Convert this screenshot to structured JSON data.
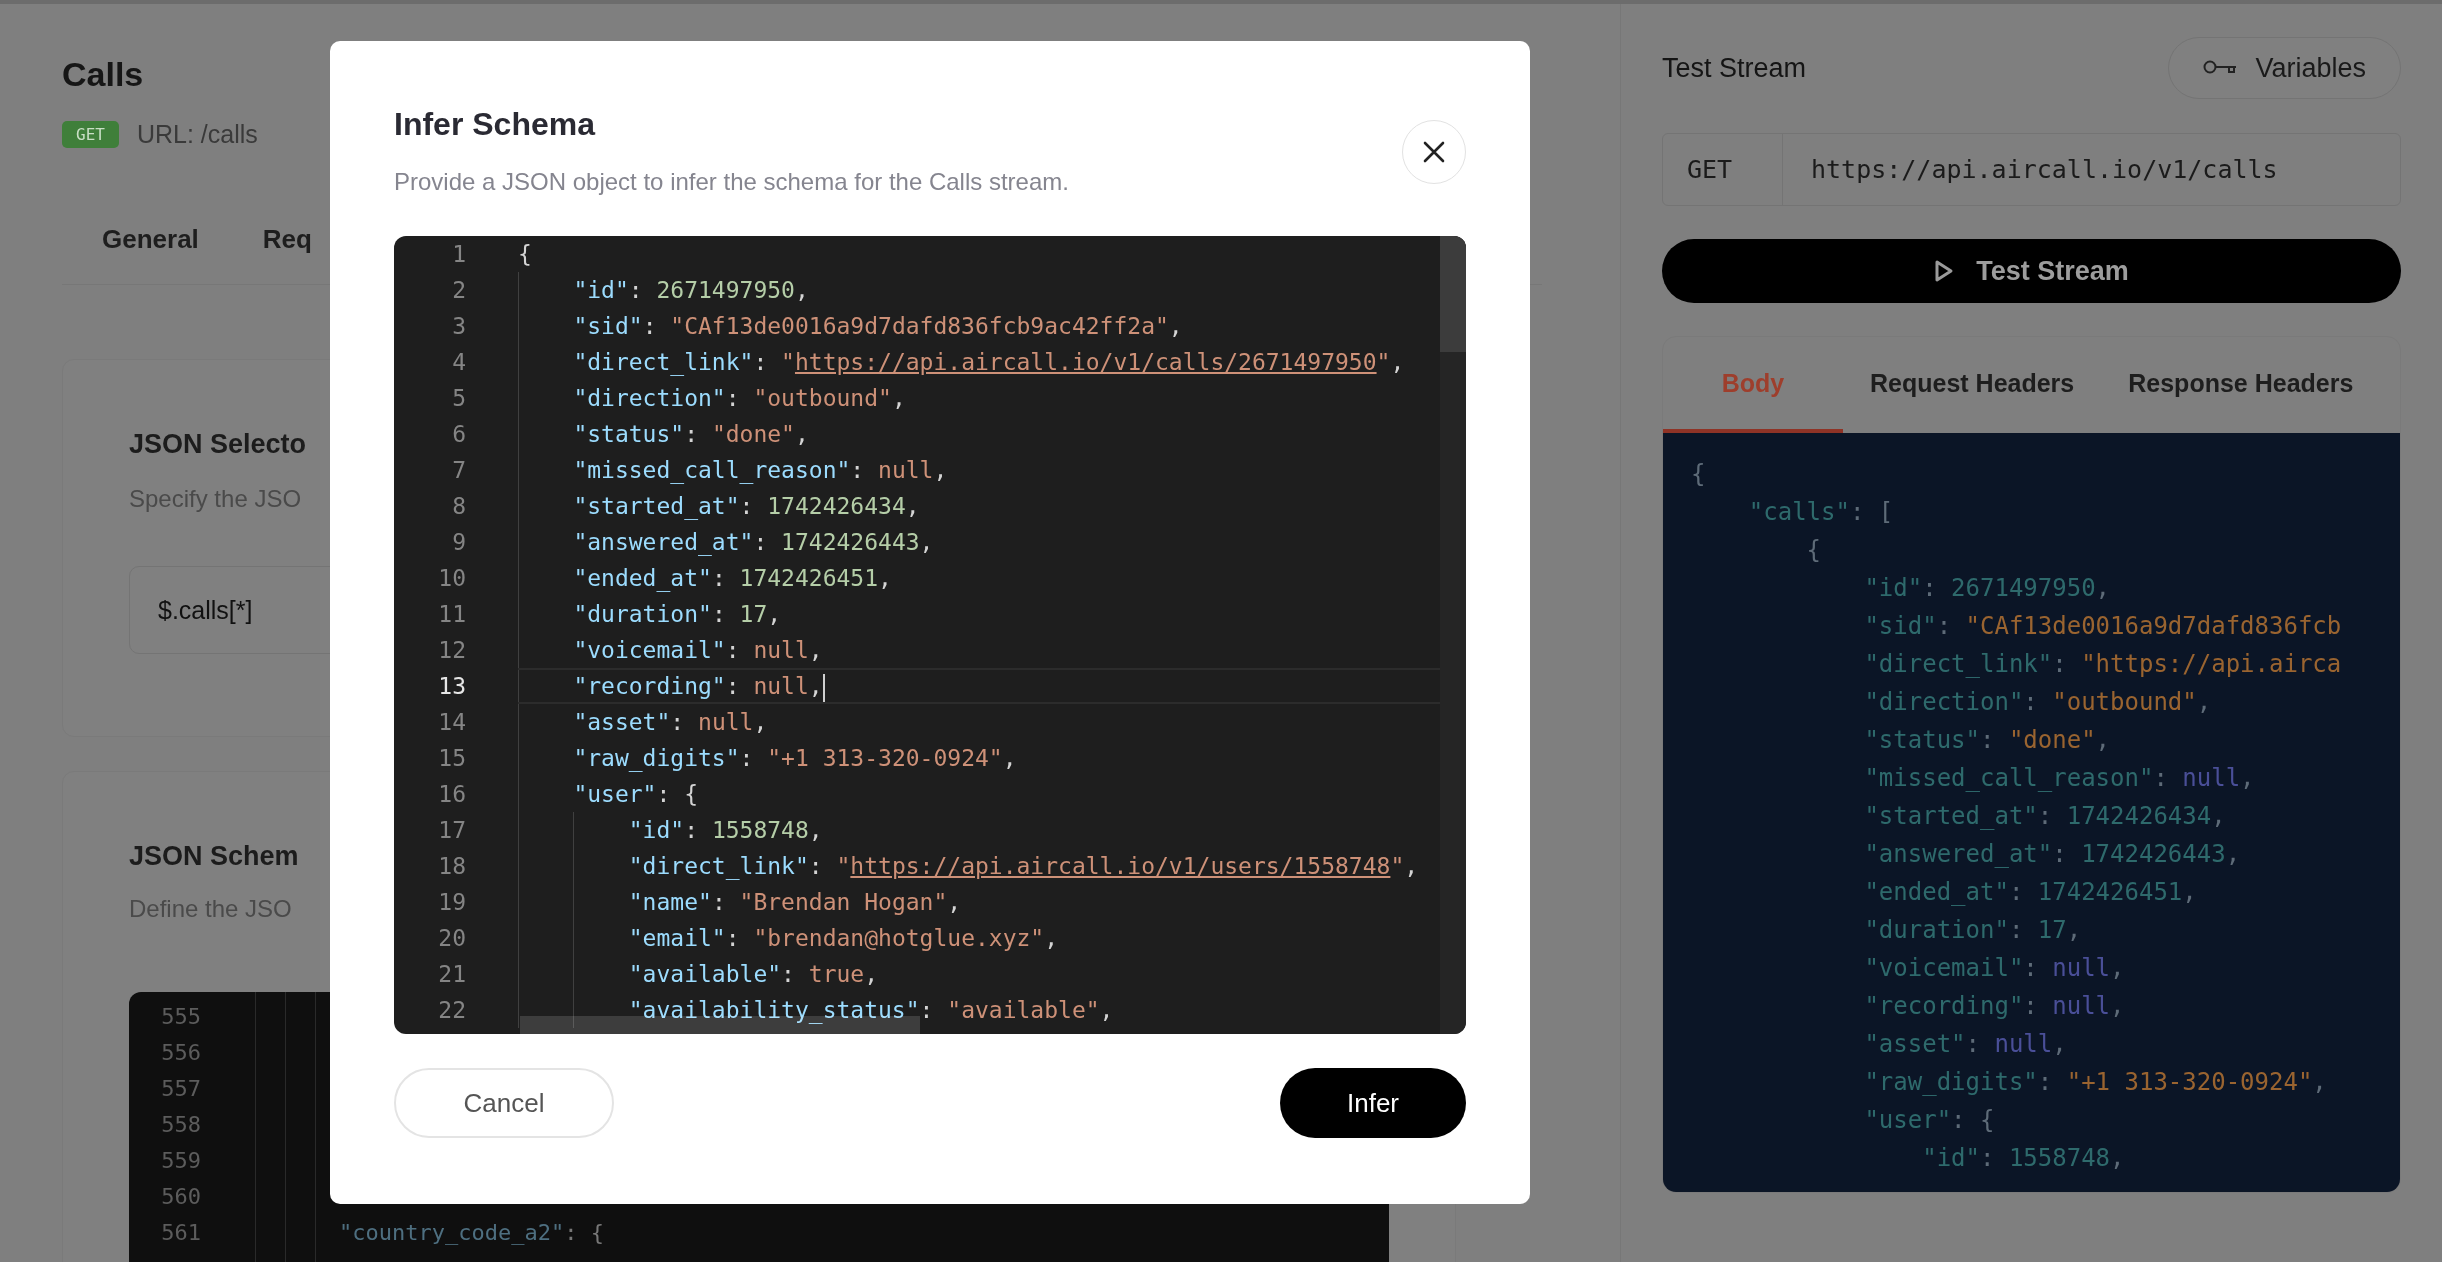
{
  "page": {
    "title": "Calls",
    "method_badge": "GET",
    "url_label": "URL: /calls",
    "tabs": [
      "General",
      "Req"
    ],
    "json_selector": {
      "title": "JSON Selecto",
      "description": "Specify the JSO",
      "value": "$.calls[*]"
    },
    "json_schema": {
      "title": "JSON Schem",
      "description": "Define the JSO",
      "editor": {
        "lines": [
          {
            "number": "555"
          },
          {
            "number": "556"
          },
          {
            "number": "557"
          },
          {
            "number": "558"
          },
          {
            "number": "559"
          },
          {
            "number": "560"
          },
          {
            "number": "561",
            "tokens": [
              {
                "kind": "key",
                "text": "\"country_code_a2\""
              },
              {
                "kind": "punct",
                "text": ": {"
              }
            ]
          }
        ]
      }
    }
  },
  "test_panel": {
    "title": "Test Stream",
    "variables_button": "Variables",
    "method": "GET",
    "url": "https://api.aircall.io/v1/calls",
    "test_button": "Test Stream",
    "response": {
      "tabs": [
        {
          "label": "Body",
          "selected": true
        },
        {
          "label": "Request Headers",
          "selected": false
        },
        {
          "label": "Response Headers",
          "selected": false
        }
      ],
      "body_lines": [
        {
          "tokens": [
            {
              "kind": "punct",
              "text": "{"
            }
          ]
        },
        {
          "tokens": [
            {
              "kind": "key",
              "text": "    \"calls\""
            },
            {
              "kind": "punct",
              "text": ": ["
            }
          ]
        },
        {
          "tokens": [
            {
              "kind": "punct",
              "text": "        {"
            }
          ]
        },
        {
          "tokens": [
            {
              "kind": "key",
              "text": "            \"id\""
            },
            {
              "kind": "punct",
              "text": ": "
            },
            {
              "kind": "num",
              "text": "2671497950"
            },
            {
              "kind": "punct",
              "text": ","
            }
          ]
        },
        {
          "tokens": [
            {
              "kind": "key",
              "text": "            \"sid\""
            },
            {
              "kind": "punct",
              "text": ": "
            },
            {
              "kind": "str",
              "text": "\"CAf13de0016a9d7dafd836fcb"
            }
          ]
        },
        {
          "tokens": [
            {
              "kind": "key",
              "text": "            \"direct_link\""
            },
            {
              "kind": "punct",
              "text": ": "
            },
            {
              "kind": "str",
              "text": "\"https://api.airca"
            }
          ]
        },
        {
          "tokens": [
            {
              "kind": "key",
              "text": "            \"direction\""
            },
            {
              "kind": "punct",
              "text": ": "
            },
            {
              "kind": "str",
              "text": "\"outbound\""
            },
            {
              "kind": "punct",
              "text": ","
            }
          ]
        },
        {
          "tokens": [
            {
              "kind": "key",
              "text": "            \"status\""
            },
            {
              "kind": "punct",
              "text": ": "
            },
            {
              "kind": "str",
              "text": "\"done\""
            },
            {
              "kind": "punct",
              "text": ","
            }
          ]
        },
        {
          "tokens": [
            {
              "kind": "key",
              "text": "            \"missed_call_reason\""
            },
            {
              "kind": "punct",
              "text": ": "
            },
            {
              "kind": "lit",
              "text": "null"
            },
            {
              "kind": "punct",
              "text": ","
            }
          ]
        },
        {
          "tokens": [
            {
              "kind": "key",
              "text": "            \"started_at\""
            },
            {
              "kind": "punct",
              "text": ": "
            },
            {
              "kind": "num",
              "text": "1742426434"
            },
            {
              "kind": "punct",
              "text": ","
            }
          ]
        },
        {
          "tokens": [
            {
              "kind": "key",
              "text": "            \"answered_at\""
            },
            {
              "kind": "punct",
              "text": ": "
            },
            {
              "kind": "num",
              "text": "1742426443"
            },
            {
              "kind": "punct",
              "text": ","
            }
          ]
        },
        {
          "tokens": [
            {
              "kind": "key",
              "text": "            \"ended_at\""
            },
            {
              "kind": "punct",
              "text": ": "
            },
            {
              "kind": "num",
              "text": "1742426451"
            },
            {
              "kind": "punct",
              "text": ","
            }
          ]
        },
        {
          "tokens": [
            {
              "kind": "key",
              "text": "            \"duration\""
            },
            {
              "kind": "punct",
              "text": ": "
            },
            {
              "kind": "num",
              "text": "17"
            },
            {
              "kind": "punct",
              "text": ","
            }
          ]
        },
        {
          "tokens": [
            {
              "kind": "key",
              "text": "            \"voicemail\""
            },
            {
              "kind": "punct",
              "text": ": "
            },
            {
              "kind": "lit",
              "text": "null"
            },
            {
              "kind": "punct",
              "text": ","
            }
          ]
        },
        {
          "tokens": [
            {
              "kind": "key",
              "text": "            \"recording\""
            },
            {
              "kind": "punct",
              "text": ": "
            },
            {
              "kind": "lit",
              "text": "null"
            },
            {
              "kind": "punct",
              "text": ","
            }
          ]
        },
        {
          "tokens": [
            {
              "kind": "key",
              "text": "            \"asset\""
            },
            {
              "kind": "punct",
              "text": ": "
            },
            {
              "kind": "lit",
              "text": "null"
            },
            {
              "kind": "punct",
              "text": ","
            }
          ]
        },
        {
          "tokens": [
            {
              "kind": "key",
              "text": "            \"raw_digits\""
            },
            {
              "kind": "punct",
              "text": ": "
            },
            {
              "kind": "str",
              "text": "\"+1 313-320-0924\""
            },
            {
              "kind": "punct",
              "text": ","
            }
          ]
        },
        {
          "tokens": [
            {
              "kind": "key",
              "text": "            \"user\""
            },
            {
              "kind": "punct",
              "text": ": {"
            }
          ]
        },
        {
          "tokens": [
            {
              "kind": "key",
              "text": "                \"id\""
            },
            {
              "kind": "punct",
              "text": ": "
            },
            {
              "kind": "num",
              "text": "1558748"
            },
            {
              "kind": "punct",
              "text": ","
            }
          ]
        }
      ]
    }
  },
  "modal": {
    "title": "Infer Schema",
    "description": "Provide a JSON object to infer the schema for the Calls stream.",
    "editor": {
      "lines": [
        {
          "number": "1",
          "active": false,
          "tokens": [
            {
              "kind": "punct",
              "text": "{"
            }
          ]
        },
        {
          "number": "2",
          "active": false,
          "tokens": [
            {
              "kind": "key",
              "text": "    \"id\""
            },
            {
              "kind": "punct",
              "text": ": "
            },
            {
              "kind": "num",
              "text": "2671497950"
            },
            {
              "kind": "punct",
              "text": ","
            }
          ]
        },
        {
          "number": "3",
          "active": false,
          "tokens": [
            {
              "kind": "key",
              "text": "    \"sid\""
            },
            {
              "kind": "punct",
              "text": ": "
            },
            {
              "kind": "str",
              "text": "\"CAf13de0016a9d7dafd836fcb9ac42ff2a\""
            },
            {
              "kind": "punct",
              "text": ","
            }
          ]
        },
        {
          "number": "4",
          "active": false,
          "tokens": [
            {
              "kind": "key",
              "text": "    \"direct_link\""
            },
            {
              "kind": "punct",
              "text": ": "
            },
            {
              "kind": "str",
              "text": "\""
            },
            {
              "kind": "link",
              "text": "https://api.aircall.io/v1/calls/2671497950"
            },
            {
              "kind": "str",
              "text": "\""
            },
            {
              "kind": "punct",
              "text": ","
            }
          ]
        },
        {
          "number": "5",
          "active": false,
          "tokens": [
            {
              "kind": "key",
              "text": "    \"direction\""
            },
            {
              "kind": "punct",
              "text": ": "
            },
            {
              "kind": "str",
              "text": "\"outbound\""
            },
            {
              "kind": "punct",
              "text": ","
            }
          ]
        },
        {
          "number": "6",
          "active": false,
          "tokens": [
            {
              "kind": "key",
              "text": "    \"status\""
            },
            {
              "kind": "punct",
              "text": ": "
            },
            {
              "kind": "str",
              "text": "\"done\""
            },
            {
              "kind": "punct",
              "text": ","
            }
          ]
        },
        {
          "number": "7",
          "active": false,
          "tokens": [
            {
              "kind": "key",
              "text": "    \"missed_call_reason\""
            },
            {
              "kind": "punct",
              "text": ": "
            },
            {
              "kind": "lit",
              "text": "null"
            },
            {
              "kind": "punct",
              "text": ","
            }
          ]
        },
        {
          "number": "8",
          "active": false,
          "tokens": [
            {
              "kind": "key",
              "text": "    \"started_at\""
            },
            {
              "kind": "punct",
              "text": ": "
            },
            {
              "kind": "num",
              "text": "1742426434"
            },
            {
              "kind": "punct",
              "text": ","
            }
          ]
        },
        {
          "number": "9",
          "active": false,
          "tokens": [
            {
              "kind": "key",
              "text": "    \"answered_at\""
            },
            {
              "kind": "punct",
              "text": ": "
            },
            {
              "kind": "num",
              "text": "1742426443"
            },
            {
              "kind": "punct",
              "text": ","
            }
          ]
        },
        {
          "number": "10",
          "active": false,
          "tokens": [
            {
              "kind": "key",
              "text": "    \"ended_at\""
            },
            {
              "kind": "punct",
              "text": ": "
            },
            {
              "kind": "num",
              "text": "1742426451"
            },
            {
              "kind": "punct",
              "text": ","
            }
          ]
        },
        {
          "number": "11",
          "active": false,
          "tokens": [
            {
              "kind": "key",
              "text": "    \"duration\""
            },
            {
              "kind": "punct",
              "text": ": "
            },
            {
              "kind": "num",
              "text": "17"
            },
            {
              "kind": "punct",
              "text": ","
            }
          ]
        },
        {
          "number": "12",
          "active": false,
          "tokens": [
            {
              "kind": "key",
              "text": "    \"voicemail\""
            },
            {
              "kind": "punct",
              "text": ": "
            },
            {
              "kind": "lit",
              "text": "null"
            },
            {
              "kind": "punct",
              "text": ","
            }
          ]
        },
        {
          "number": "13",
          "active": true,
          "tokens": [
            {
              "kind": "key",
              "text": "    \"recording\""
            },
            {
              "kind": "punct",
              "text": ": "
            },
            {
              "kind": "lit",
              "text": "null"
            },
            {
              "kind": "punct",
              "text": ","
            }
          ]
        },
        {
          "number": "14",
          "active": false,
          "tokens": [
            {
              "kind": "key",
              "text": "    \"asset\""
            },
            {
              "kind": "punct",
              "text": ": "
            },
            {
              "kind": "lit",
              "text": "null"
            },
            {
              "kind": "punct",
              "text": ","
            }
          ]
        },
        {
          "number": "15",
          "active": false,
          "tokens": [
            {
              "kind": "key",
              "text": "    \"raw_digits\""
            },
            {
              "kind": "punct",
              "text": ": "
            },
            {
              "kind": "str",
              "text": "\"+1 313-320-0924\""
            },
            {
              "kind": "punct",
              "text": ","
            }
          ]
        },
        {
          "number": "16",
          "active": false,
          "tokens": [
            {
              "kind": "key",
              "text": "    \"user\""
            },
            {
              "kind": "punct",
              "text": ": {"
            }
          ]
        },
        {
          "number": "17",
          "active": false,
          "tokens": [
            {
              "kind": "key",
              "text": "        \"id\""
            },
            {
              "kind": "punct",
              "text": ": "
            },
            {
              "kind": "num",
              "text": "1558748"
            },
            {
              "kind": "punct",
              "text": ","
            }
          ]
        },
        {
          "number": "18",
          "active": false,
          "tokens": [
            {
              "kind": "key",
              "text": "        \"direct_link\""
            },
            {
              "kind": "punct",
              "text": ": "
            },
            {
              "kind": "str",
              "text": "\""
            },
            {
              "kind": "link",
              "text": "https://api.aircall.io/v1/users/1558748"
            },
            {
              "kind": "str",
              "text": "\""
            },
            {
              "kind": "punct",
              "text": ","
            }
          ]
        },
        {
          "number": "19",
          "active": false,
          "tokens": [
            {
              "kind": "key",
              "text": "        \"name\""
            },
            {
              "kind": "punct",
              "text": ": "
            },
            {
              "kind": "str",
              "text": "\"Brendan Hogan\""
            },
            {
              "kind": "punct",
              "text": ","
            }
          ]
        },
        {
          "number": "20",
          "active": false,
          "tokens": [
            {
              "kind": "key",
              "text": "        \"email\""
            },
            {
              "kind": "punct",
              "text": ": "
            },
            {
              "kind": "str",
              "text": "\"brendan@hotglue.xyz\""
            },
            {
              "kind": "punct",
              "text": ","
            }
          ]
        },
        {
          "number": "21",
          "active": false,
          "tokens": [
            {
              "kind": "key",
              "text": "        \"available\""
            },
            {
              "kind": "punct",
              "text": ": "
            },
            {
              "kind": "lit",
              "text": "true"
            },
            {
              "kind": "punct",
              "text": ","
            }
          ]
        },
        {
          "number": "22",
          "active": false,
          "tokens": [
            {
              "kind": "key",
              "text": "        \"availability_status\""
            },
            {
              "kind": "punct",
              "text": ": "
            },
            {
              "kind": "str",
              "text": "\"available\""
            },
            {
              "kind": "punct",
              "text": ","
            }
          ]
        }
      ]
    },
    "buttons": [
      {
        "kind": "secondary",
        "label": "Cancel"
      },
      {
        "kind": "primary",
        "label": "Infer"
      }
    ]
  }
}
